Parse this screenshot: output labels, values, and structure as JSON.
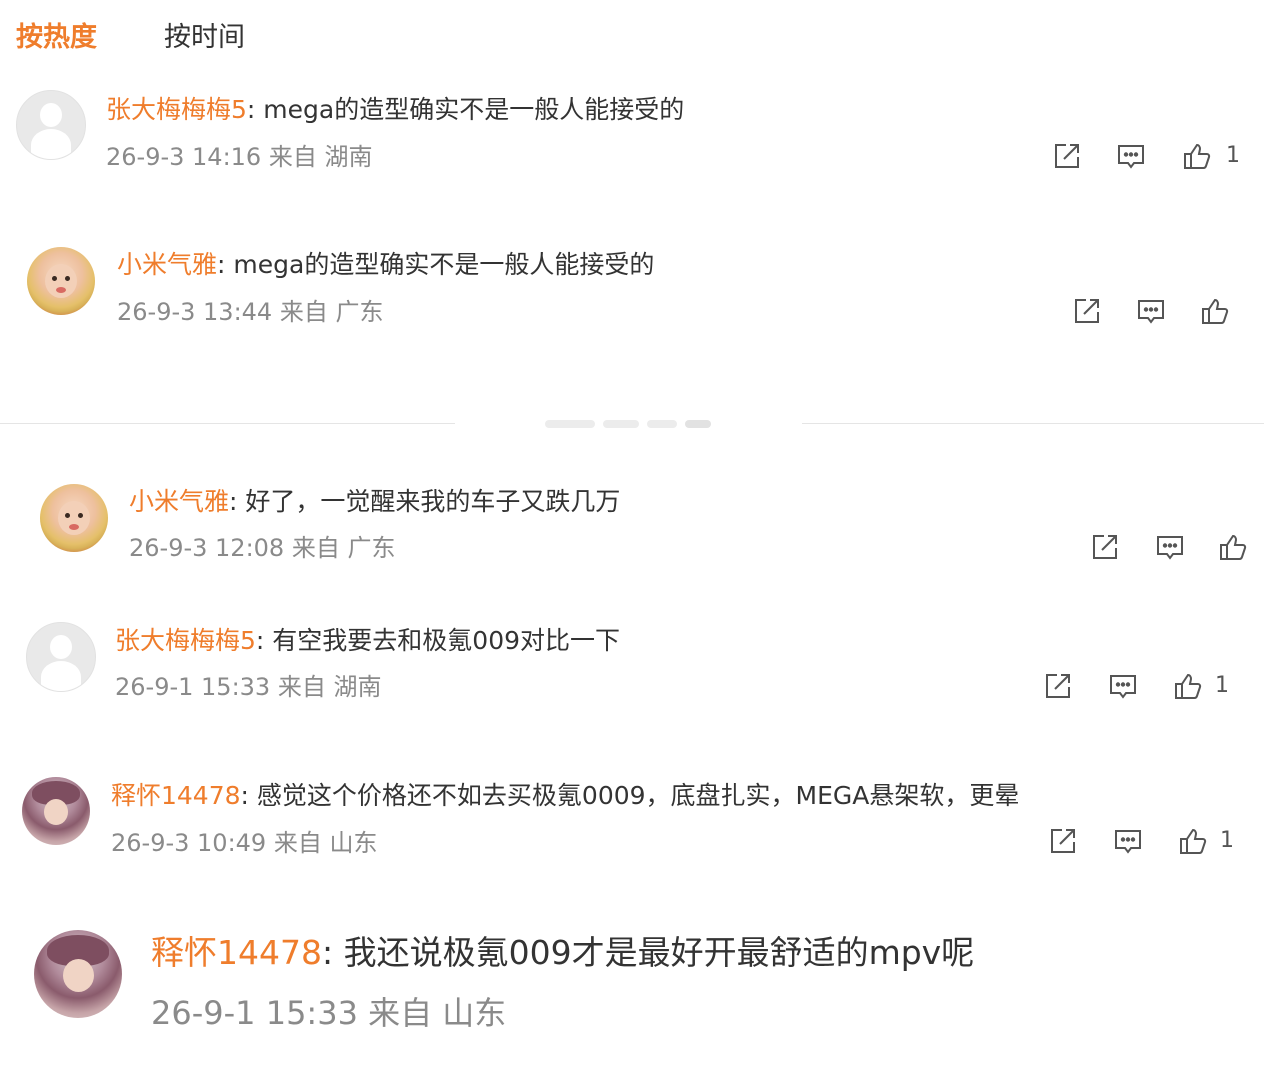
{
  "tabs": {
    "hot": "按热度",
    "time": "按时间"
  },
  "colors": {
    "accent": "#ef7d2c",
    "text": "#333333",
    "meta": "#8a8a8a",
    "icon": "#555555"
  },
  "icons": [
    "share-icon",
    "comment-icon",
    "like-icon"
  ],
  "comments": [
    {
      "user": "张大梅梅梅5",
      "colon": ":",
      "text": " mega的造型确实不是一般人能接受的",
      "meta": "26-9-3 14:16 来自 湖南",
      "likes": "1",
      "avatar": "default-avatar"
    },
    {
      "user": "小米气雅",
      "colon": ":",
      "text": " mega的造型确实不是一般人能接受的",
      "meta": "26-9-3 13:44 来自 广东",
      "likes": "",
      "avatar": "baby-avatar"
    },
    {
      "user": "小米气雅",
      "colon": ":",
      "text": " 好了，一觉醒来我的车子又跌几万",
      "meta": "26-9-3 12:08 来自 广东",
      "likes": "",
      "avatar": "baby-avatar"
    },
    {
      "user": "张大梅梅梅5",
      "colon": ":",
      "text": " 有空我要去和极氪009对比一下",
      "meta": "26-9-1 15:33 来自 湖南",
      "likes": "1",
      "avatar": "default-avatar"
    },
    {
      "user": "释怀14478",
      "colon": ":",
      "text": " 感觉这个价格还不如去买极氪0009，底盘扎实，MEGA悬架软，更晕",
      "meta": "26-9-3 10:49 来自 山东",
      "likes": "1",
      "avatar": "girl-avatar"
    },
    {
      "user": "释怀14478",
      "colon": ":",
      "text": " 我还说极氪009才是最好开最舒适的mpv呢",
      "meta": "26-9-1 15:33 来自 山东",
      "likes": "",
      "avatar": "girl-avatar"
    }
  ]
}
